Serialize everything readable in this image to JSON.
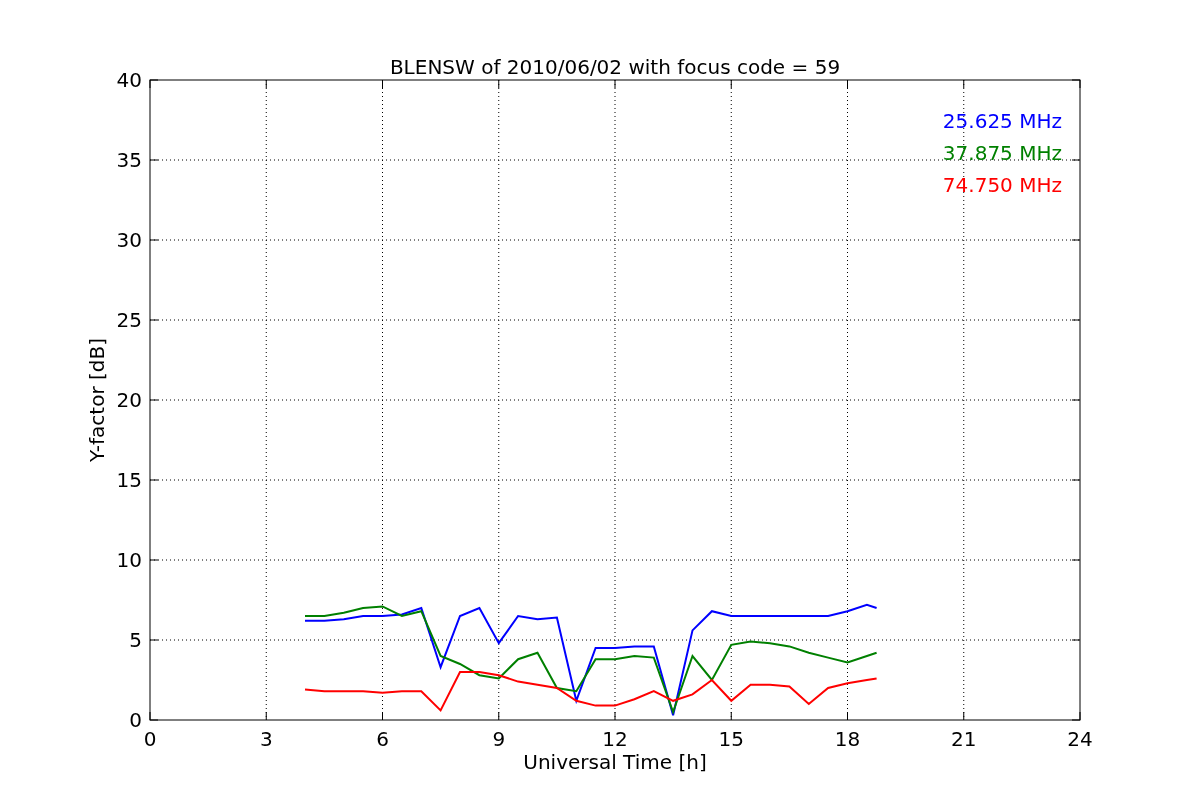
{
  "chart_data": {
    "type": "line",
    "title": "BLENSW of 2010/06/02 with focus code = 59",
    "xlabel": "Universal Time [h]",
    "ylabel": "Y-factor [dB]",
    "x": [
      4,
      4.5,
      5,
      5.5,
      6,
      6.5,
      7,
      7.5,
      8,
      8.5,
      9,
      9.5,
      10,
      10.5,
      11,
      11.5,
      12,
      12.5,
      13,
      13.5,
      14,
      14.5,
      15,
      15.5,
      16,
      16.5,
      17,
      17.5,
      18,
      18.5,
      18.75
    ],
    "series": [
      {
        "name": "25.625 MHz",
        "color": "#0000ff",
        "values": [
          6.2,
          6.2,
          6.3,
          6.5,
          6.5,
          6.6,
          7.0,
          3.3,
          6.5,
          7.0,
          4.8,
          6.5,
          6.3,
          6.4,
          1.2,
          4.5,
          4.5,
          4.6,
          4.6,
          0.3,
          5.6,
          6.8,
          6.5,
          6.5,
          6.5,
          6.5,
          6.5,
          6.5,
          6.8,
          7.2,
          7.0
        ]
      },
      {
        "name": "37.875 MHz",
        "color": "#008000",
        "values": [
          6.5,
          6.5,
          6.7,
          7.0,
          7.1,
          6.5,
          6.8,
          4.0,
          3.5,
          2.8,
          2.6,
          3.8,
          4.2,
          2.0,
          1.8,
          3.8,
          3.8,
          4.0,
          3.9,
          0.5,
          4.0,
          2.5,
          4.7,
          4.9,
          4.8,
          4.6,
          4.2,
          3.9,
          3.6,
          4.0,
          4.2
        ]
      },
      {
        "name": "74.750 MHz",
        "color": "#ff0000",
        "values": [
          1.9,
          1.8,
          1.8,
          1.8,
          1.7,
          1.8,
          1.8,
          0.6,
          3.0,
          3.0,
          2.8,
          2.4,
          2.2,
          2.0,
          1.2,
          0.9,
          0.9,
          1.3,
          1.8,
          1.2,
          1.6,
          2.5,
          1.2,
          2.2,
          2.2,
          2.1,
          1.0,
          2.0,
          2.3,
          2.5,
          2.6
        ]
      }
    ],
    "grid": true,
    "xlim": [
      0,
      24
    ],
    "ylim": [
      0,
      40
    ],
    "xticks": [
      0,
      3,
      6,
      9,
      12,
      15,
      18,
      21,
      24
    ],
    "yticks": [
      0,
      5,
      10,
      15,
      20,
      25,
      30,
      35,
      40
    ]
  }
}
